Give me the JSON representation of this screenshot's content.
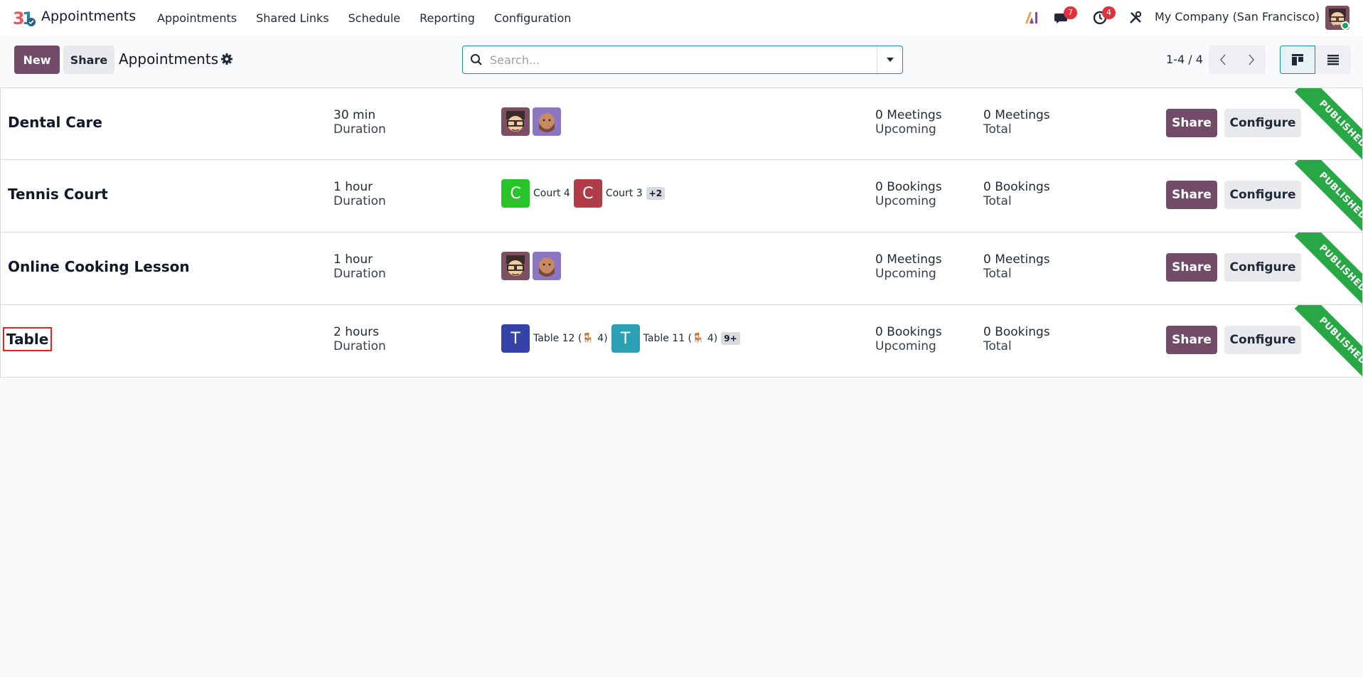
{
  "navbar": {
    "app_name": "Appointments",
    "menu": [
      "Appointments",
      "Shared Links",
      "Schedule",
      "Reporting",
      "Configuration"
    ],
    "messages_count": "7",
    "activities_count": "4",
    "company": "My Company (San Francisco)",
    "icons": [
      "ai-icon",
      "chat-icon",
      "clock-icon",
      "tools-icon"
    ]
  },
  "control_panel": {
    "new_label": "New",
    "share_label": "Share",
    "breadcrumb": "Appointments",
    "search_placeholder": "Search...",
    "pager": "1-4 / 4",
    "views": [
      "kanban",
      "list"
    ]
  },
  "colors": {
    "primary": "#714b67",
    "published": "#28a745",
    "accent": "#1f8aa1"
  },
  "records": [
    {
      "title": "Dental Care",
      "duration": "30 min",
      "duration_label": "Duration",
      "upcoming": "0 Meetings",
      "upcoming_label": "Upcoming",
      "total": "0 Meetings",
      "total_label": "Total",
      "share": "Share",
      "configure": "Configure",
      "ribbon": "PUBLISHED"
    },
    {
      "title": "Tennis Court",
      "duration": "1 hour",
      "duration_label": "Duration",
      "resources": [
        {
          "letter": "C",
          "name": "Court 4",
          "color": "#28c428"
        },
        {
          "letter": "C",
          "name": "Court 3",
          "color": "#b03c48"
        }
      ],
      "more": "+2",
      "upcoming": "0 Bookings",
      "upcoming_label": "Upcoming",
      "total": "0 Bookings",
      "total_label": "Total",
      "share": "Share",
      "configure": "Configure",
      "ribbon": "PUBLISHED"
    },
    {
      "title": "Online Cooking Lesson",
      "duration": "1 hour",
      "duration_label": "Duration",
      "upcoming": "0 Meetings",
      "upcoming_label": "Upcoming",
      "total": "0 Meetings",
      "total_label": "Total",
      "share": "Share",
      "configure": "Configure",
      "ribbon": "PUBLISHED"
    },
    {
      "title": "Table",
      "duration": "2 hours",
      "duration_label": "Duration",
      "resources": [
        {
          "letter": "T",
          "name": "Table 12 (🪑 4)",
          "color": "#3543a8"
        },
        {
          "letter": "T",
          "name": "Table 11 (🪑 4)",
          "color": "#2b9fb4"
        }
      ],
      "more": "9+",
      "upcoming": "0 Bookings",
      "upcoming_label": "Upcoming",
      "total": "0 Bookings",
      "total_label": "Total",
      "share": "Share",
      "configure": "Configure",
      "ribbon": "PUBLISHED"
    }
  ]
}
